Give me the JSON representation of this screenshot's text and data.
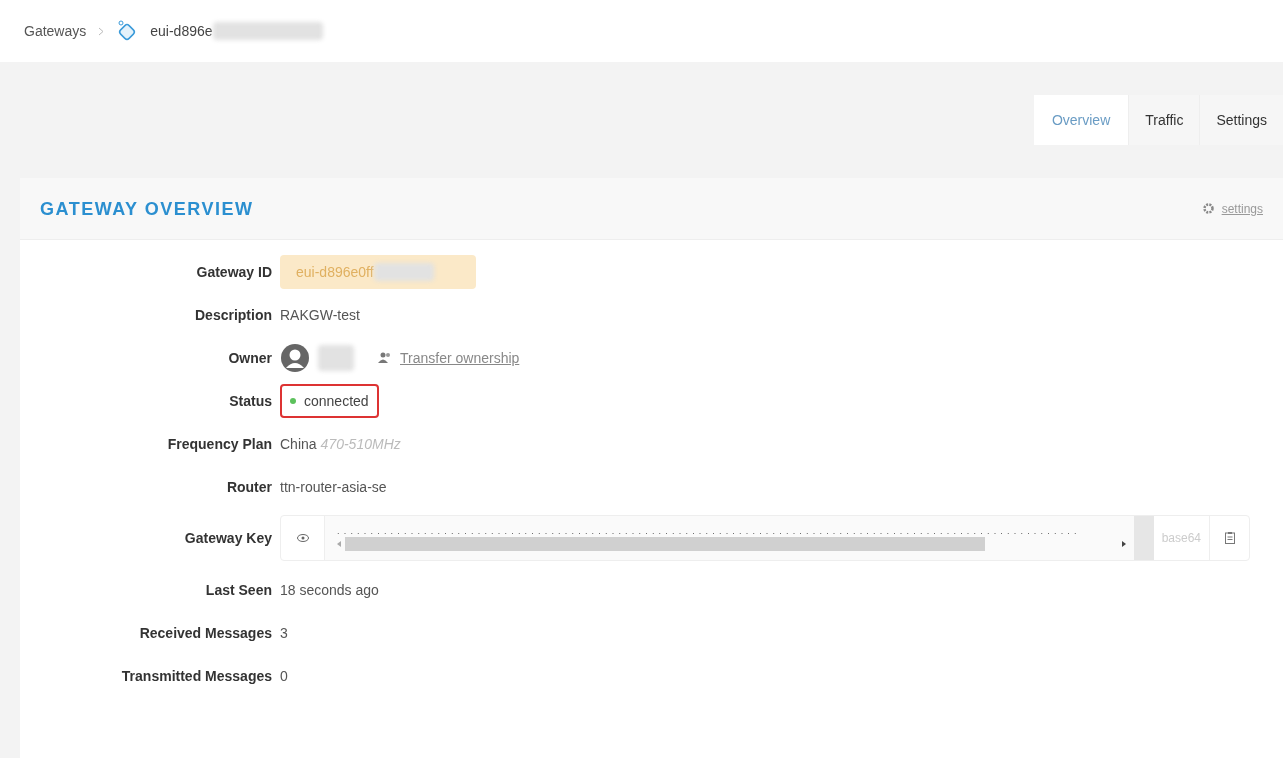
{
  "breadcrumb": {
    "parent": "Gateways",
    "current": "eui-d896e"
  },
  "tabs": [
    {
      "label": "Overview",
      "selected": true
    },
    {
      "label": "Traffic",
      "selected": false
    },
    {
      "label": "Settings",
      "selected": false
    }
  ],
  "card": {
    "title": "GATEWAY OVERVIEW",
    "settings_link": "settings"
  },
  "fields": [
    {
      "kind": "id",
      "label": "Gateway ID",
      "value": "eui-d896e0ff"
    },
    {
      "kind": "text",
      "label": "Description",
      "value": "RAKGW-test"
    },
    {
      "kind": "owner",
      "label": "Owner",
      "link": "Transfer ownership"
    },
    {
      "kind": "status",
      "label": "Status",
      "value": "connected",
      "color": "#5cc15c"
    },
    {
      "kind": "frequency",
      "label": "Frequency Plan",
      "value": "China",
      "detail": "470-510MHz"
    },
    {
      "kind": "text",
      "label": "Router",
      "value": "ttn-router-asia-se"
    },
    {
      "kind": "key",
      "label": "Gateway Key",
      "value": "...............................................................................................................",
      "addon": "base64"
    },
    {
      "kind": "text",
      "label": "Last Seen",
      "value": "18 seconds ago"
    },
    {
      "kind": "text",
      "label": "Received Messages",
      "value": "3"
    },
    {
      "kind": "text",
      "label": "Transmitted Messages",
      "value": "0"
    }
  ]
}
